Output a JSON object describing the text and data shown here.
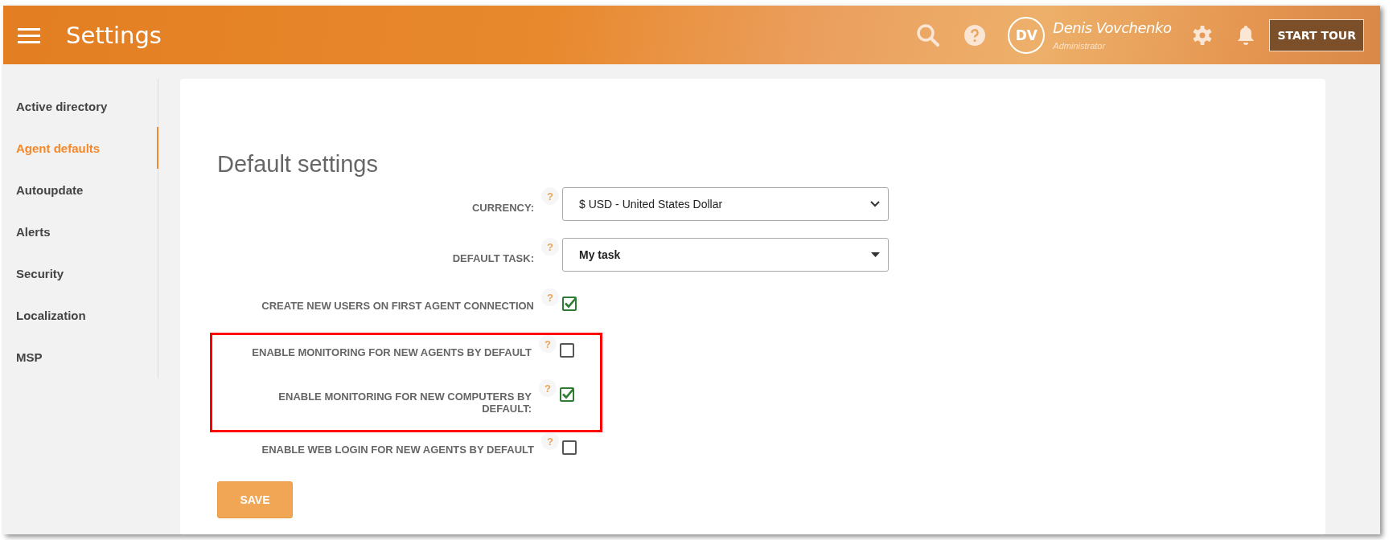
{
  "header": {
    "title": "Settings",
    "user": {
      "initials": "DV",
      "name": "Denis Vovchenko",
      "role": "Administrator"
    },
    "tour_button": "START TOUR"
  },
  "sidebar": {
    "items": [
      {
        "label": "Active directory",
        "selected": false
      },
      {
        "label": "Agent defaults",
        "selected": true
      },
      {
        "label": "Autoupdate",
        "selected": false
      },
      {
        "label": "Alerts",
        "selected": false
      },
      {
        "label": "Security",
        "selected": false
      },
      {
        "label": "Localization",
        "selected": false
      },
      {
        "label": "MSP",
        "selected": false
      }
    ]
  },
  "panel": {
    "title": "Default settings",
    "fields": [
      {
        "kind": "select",
        "label": "CURRENCY:",
        "value": "$ USD - United States Dollar"
      },
      {
        "kind": "dropdown",
        "label": "DEFAULT TASK:",
        "value": "My task"
      }
    ],
    "options": [
      {
        "label": "CREATE NEW USERS ON FIRST AGENT CONNECTION",
        "checked": true,
        "highlighted": false
      },
      {
        "label": "ENABLE MONITORING FOR NEW AGENTS BY DEFAULT",
        "checked": false,
        "highlighted": true
      },
      {
        "label": "ENABLE MONITORING FOR NEW COMPUTERS BY DEFAULT:",
        "checked": true,
        "highlighted": true
      },
      {
        "label": "ENABLE WEB LOGIN FOR NEW AGENTS BY DEFAULT",
        "checked": false,
        "highlighted": false
      }
    ],
    "help_mark": "?",
    "save_button": "SAVE"
  }
}
